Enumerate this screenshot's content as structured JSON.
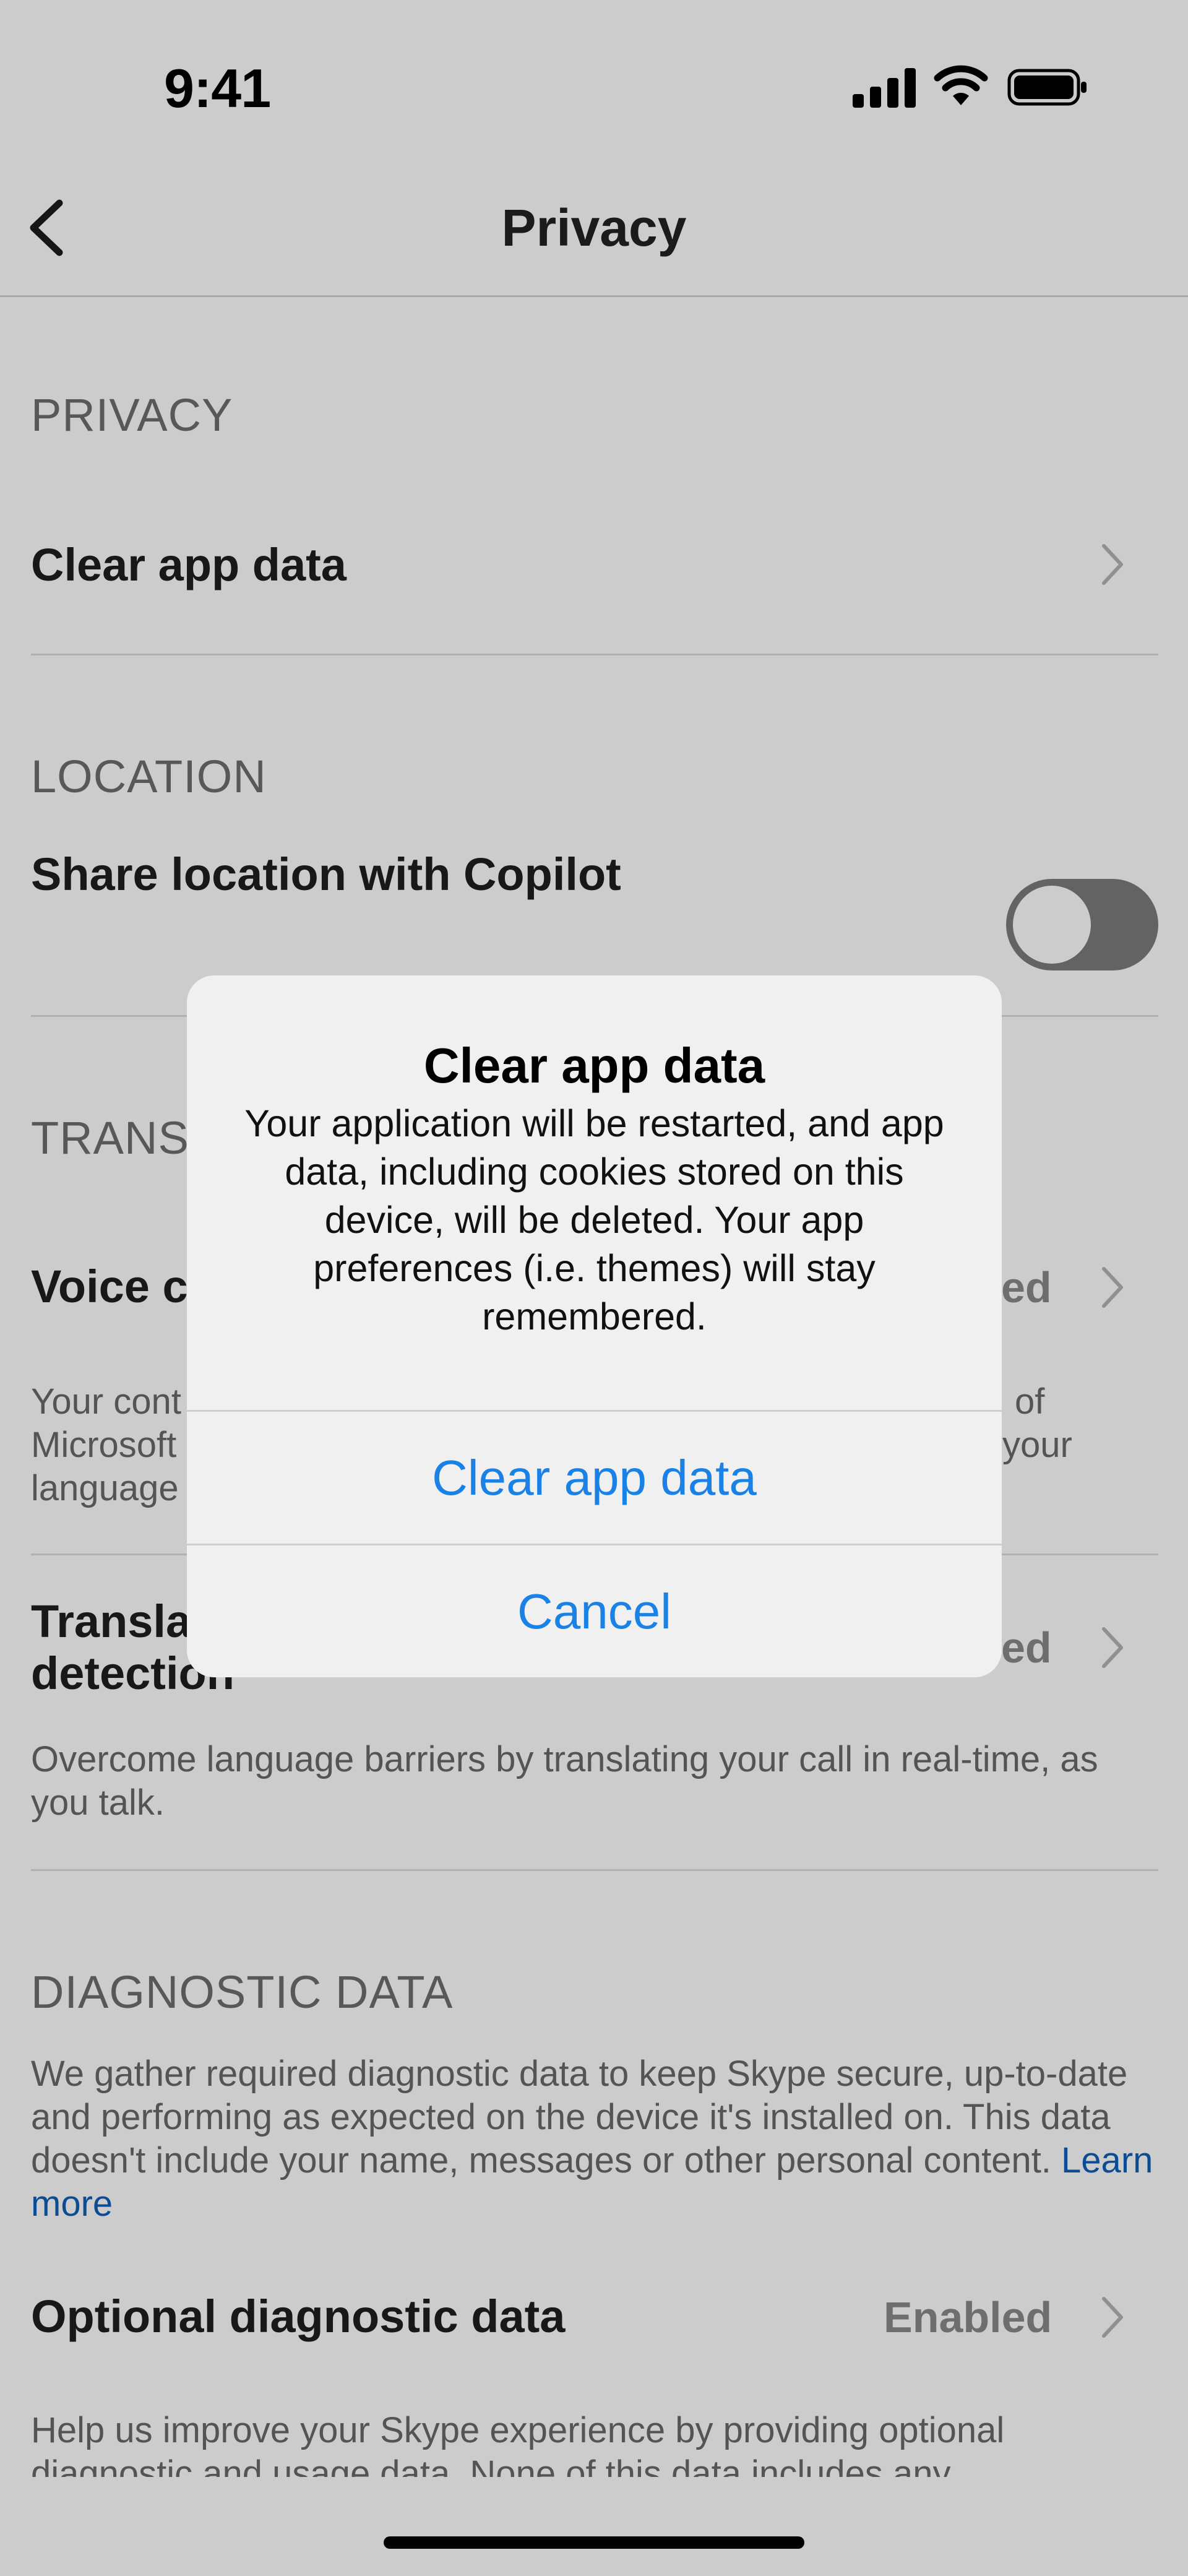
{
  "status_bar": {
    "time": "9:41",
    "signal_icon": "signal-bars-icon",
    "wifi_icon": "wifi-icon",
    "battery_icon": "battery-full-icon"
  },
  "nav": {
    "title": "Privacy",
    "back_icon": "chevron-left-icon"
  },
  "sections": {
    "privacy": {
      "header": "PRIVACY",
      "clear_app_data": "Clear app data"
    },
    "location": {
      "header": "LOCATION",
      "share_location": "Share location with Copilot",
      "toggle_on": false
    },
    "translation": {
      "header": "TRANS",
      "voice_title": "Voice c",
      "voice_value": "ed",
      "voice_desc_lines": [
        "Your cont",
        "Microsoft",
        "language"
      ],
      "voice_desc_right": [
        "of",
        "your"
      ],
      "translate_title_lines": [
        "Transla",
        "detection"
      ],
      "translate_value": "ed",
      "translate_desc": "Overcome language barriers by translating your call in real-time, as you talk."
    },
    "diagnostic": {
      "header": "DIAGNOSTIC DATA",
      "desc": "We gather required diagnostic data to keep Skype secure, up-to-date and performing as expected on the device it's installed on. This data doesn't include your name, messages or other personal content.",
      "learn_more": "Learn more",
      "optional_title": "Optional diagnostic data",
      "optional_value": "Enabled",
      "optional_desc": "Help us improve your Skype experience by providing optional diagnostic and usage data. None of this data includes any"
    }
  },
  "dialog": {
    "title": "Clear app data",
    "message": "Your application will be restarted, and app data, including cookies stored on this device, will be deleted. Your app preferences (i.e. themes) will stay remembered.",
    "confirm_label": "Clear app data",
    "cancel_label": "Cancel"
  },
  "colors": {
    "accent": "#1a82e6",
    "link": "#0f5fb8",
    "overlay": "rgba(0,0,0,0.2)"
  }
}
